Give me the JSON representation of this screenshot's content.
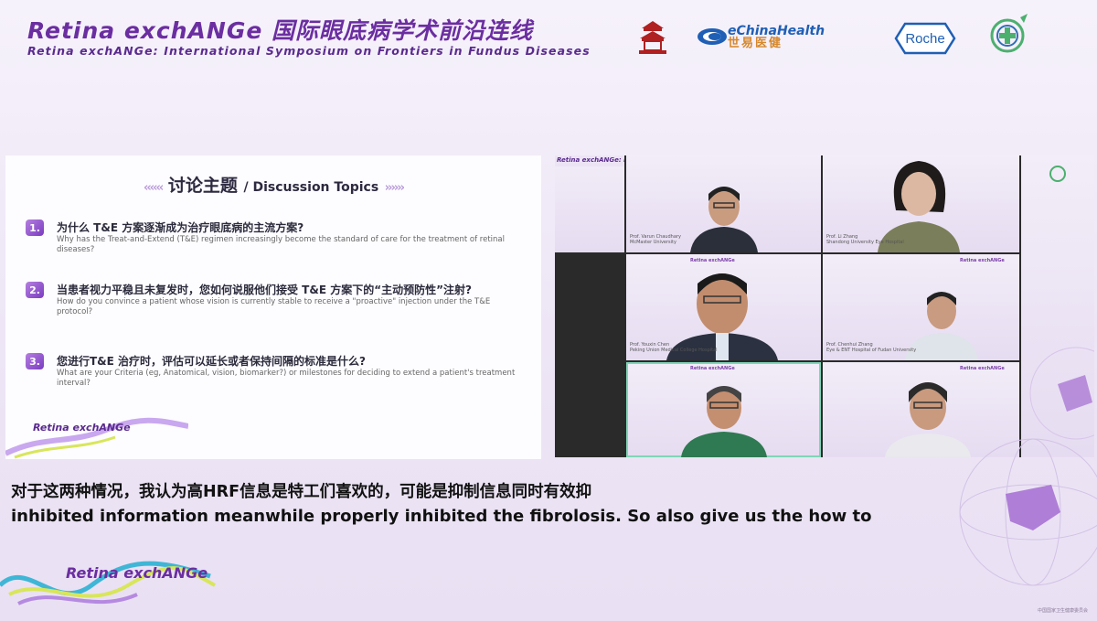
{
  "header": {
    "title_zh": "Retina exchANGe 国际眼底病学术前沿连线",
    "title_en": "Retina exchANGe: International Symposium on Frontiers in Fundus Diseases",
    "logos": {
      "temple_icon": "temple-seal-icon",
      "echina_en": "eChinaHealth",
      "echina_zh": "世易医健",
      "roche": "Roche",
      "circle_icon": "circle-cross-icon"
    }
  },
  "slide": {
    "title_zh": "讨论主题",
    "title_en": "/ Discussion Topics",
    "questions": [
      {
        "num": "1.",
        "zh": "为什么 T&E 方案逐渐成为治疗眼底病的主流方案?",
        "en": "Why has the Treat-and-Extend (T&E) regimen increasingly become the standard of care for the treatment of retinal diseases?"
      },
      {
        "num": "2.",
        "zh": "当患者视力平稳且未复发时，您如何说服他们接受 T&E 方案下的“主动预防性”注射?",
        "en": "How do you convince a patient whose vision is currently stable to receive a \"proactive\" injection under the T&E protocol?"
      },
      {
        "num": "3.",
        "zh": "您进行T&E 治疗时，评估可以延长或者保持间隔的标准是什么?",
        "en": "What are your Criteria (eg, Anatomical, vision, biomarker?) or milestones for deciding to extend a patient's treatment interval?"
      }
    ],
    "brand": "Retina exchANGe"
  },
  "video": {
    "top_banner": "Retina exchANGe: Inter",
    "participants": [
      {
        "name": "Prof. Varun Chaudhary",
        "affil": "McMaster University"
      },
      {
        "name": "Prof. Li Zhang",
        "affil": "Shandong University Eye Hospital"
      },
      {
        "name": "Prof. Youxin Chen",
        "affil": "Peking Union Medical College Hospital"
      },
      {
        "name": "Prof. Chenhui Zhang",
        "affil": "Eye & ENT Hospital of Fudan University"
      },
      {
        "name": "",
        "affil": ""
      },
      {
        "name": "",
        "affil": ""
      }
    ],
    "tile_title": "Retina exchANGe"
  },
  "subtitles": {
    "zh": "对于这两种情况，我认为高HRF信息是特工们喜欢的，可能是抑制信息同时有效抑",
    "en": "inhibited information meanwhile properly inhibited the fibrolosis. So also give us the how to"
  },
  "footer": {
    "brand": "Retina exchANGe",
    "note": "中国国家卫生健康委员会"
  },
  "colors": {
    "brand_purple": "#6b2ea0",
    "accent_green": "#7fd6b6",
    "roche_blue": "#1f5fb5"
  }
}
